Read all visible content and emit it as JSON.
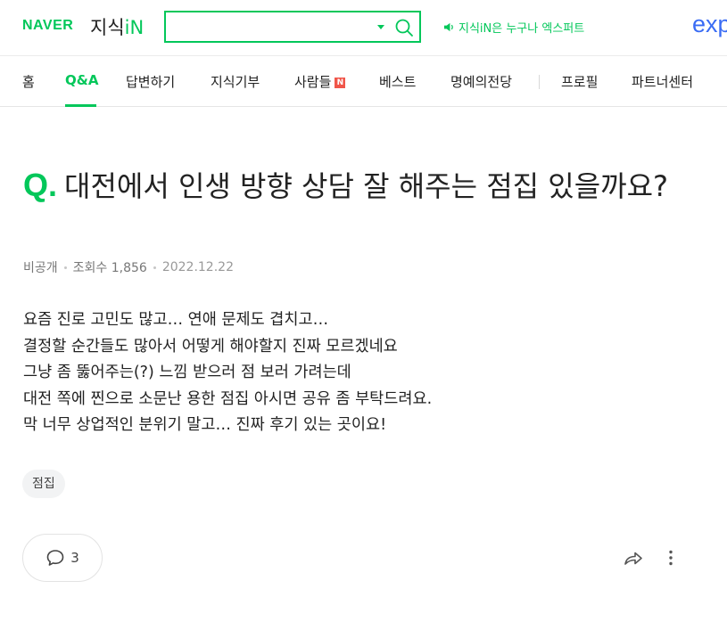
{
  "header": {
    "logo_naver": "NAVER",
    "logo_jisik": "지식",
    "logo_in": "iN",
    "search": {
      "value": "",
      "placeholder": ""
    },
    "promo_text": "지식iN은 누구나 엑스퍼트",
    "brand_right": "exp",
    "accent": "#03c75a",
    "brand_right_color": "#3a6cf4"
  },
  "nav": {
    "items": [
      {
        "label": "홈"
      },
      {
        "label": "Q&A"
      },
      {
        "label": "답변하기"
      },
      {
        "label": "지식기부"
      },
      {
        "label": "사람들"
      },
      {
        "label": "베스트"
      },
      {
        "label": "명예의전당"
      },
      {
        "label": "프로필"
      },
      {
        "label": "파트너센터"
      }
    ],
    "active": "Q&A",
    "new_badge": "N"
  },
  "question": {
    "q_mark": "Q.",
    "title": "대전에서 인생 방향 상담 잘 해주는 점집 있을까요?",
    "author": "비공개",
    "views": "조회수 1,856",
    "date": "2022.12.22",
    "body": [
      "요즘 진로 고민도 많고… 연애 문제도 겹치고…",
      "결정할 순간들도 많아서 어떻게 해야할지 진짜 모르겠네요",
      "그냥 좀 뚫어주는(?) 느낌 받으러 점 보러 가려는데",
      "대전 쪽에 찐으로 소문난 용한 점집 아시면 공유 좀 부탁드려요.",
      "막 너무 상업적인 분위기 말고… 진짜 후기 있는 곳이요!"
    ],
    "tag": "점집"
  },
  "actions": {
    "comment_count": "3",
    "comment_icon": "speech-bubble-icon",
    "share_icon": "share-arrow-icon",
    "more_icon": "vertical-dots-icon"
  }
}
